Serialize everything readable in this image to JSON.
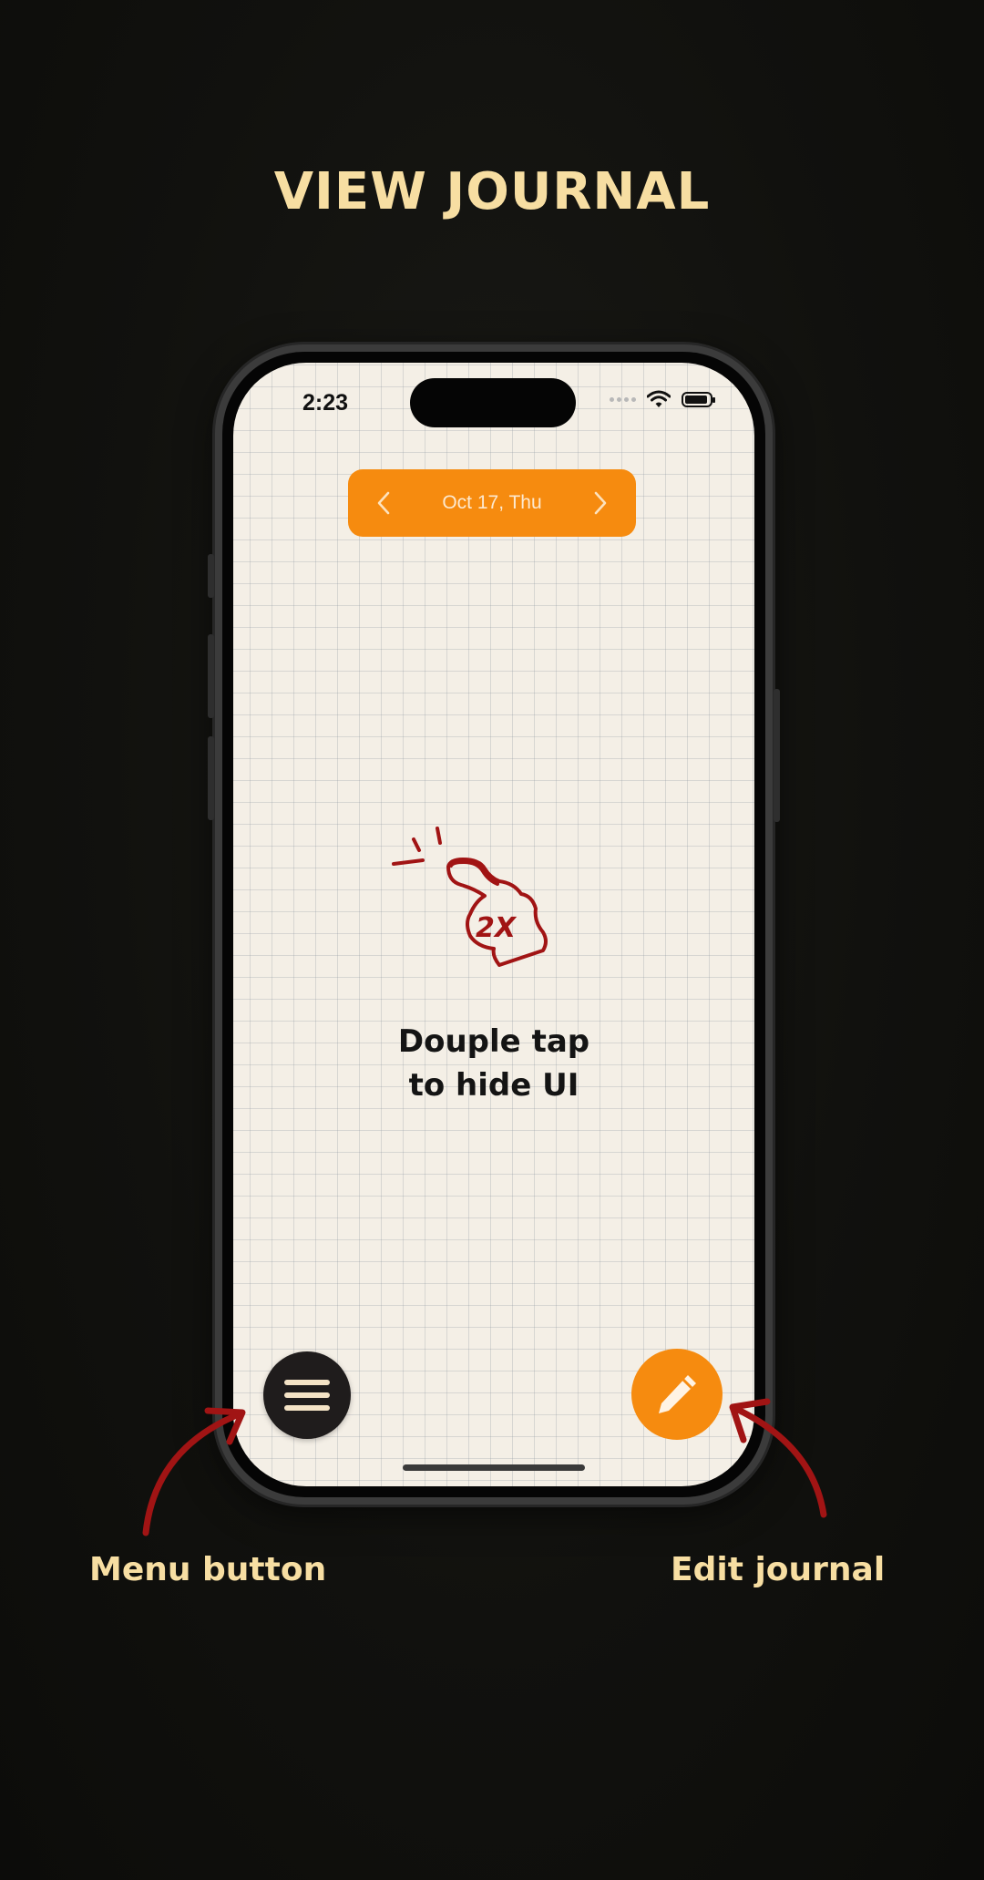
{
  "headline": "VIEW JOURNAL",
  "status_bar": {
    "time": "2:23"
  },
  "date_nav": {
    "date": "Oct 17, Thu",
    "prev_icon": "chevron-left-icon",
    "next_icon": "chevron-right-icon"
  },
  "hint": {
    "gesture_label": "2X",
    "line1": "Douple tap",
    "line2": "to hide UI"
  },
  "menu_button": {
    "icon": "hamburger-menu-icon"
  },
  "edit_button": {
    "icon": "pencil-icon"
  },
  "callouts": {
    "menu": "Menu button",
    "edit": "Edit journal"
  },
  "colors": {
    "background": "#11110e",
    "headline": "#f7dea2",
    "accent_orange": "#f68b0f",
    "paper": "#f4efe6",
    "annotation_red": "#a11414",
    "menu_button": "#1f1c1c"
  }
}
